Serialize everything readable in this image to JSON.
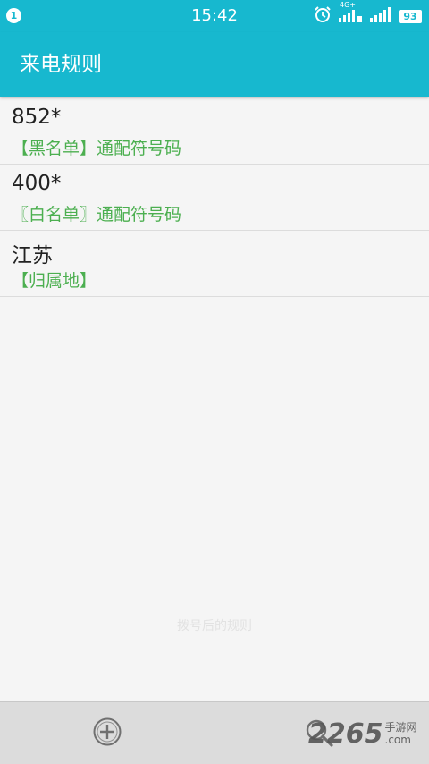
{
  "status_bar": {
    "notification_count": "1",
    "time": "15:42",
    "network_label": "4G+",
    "battery": "93",
    "icons": [
      "alarm-icon",
      "signal-4g-icon",
      "signal-icon"
    ]
  },
  "app_bar": {
    "title": "来电规则"
  },
  "rules": [
    {
      "number": "852*",
      "desc": "【黑名单】通配符号码"
    },
    {
      "number": "400*",
      "desc": "〖白名单〗通配符号码"
    },
    {
      "number": "江苏",
      "desc": "【归属地】"
    }
  ],
  "toast": "拨号后的规则",
  "bottom_bar": {
    "add_icon": "plus-circle-icon",
    "search_icon": "search-icon"
  },
  "watermark": {
    "number": "2265",
    "line1": "手游网",
    "line2": ".com"
  },
  "colors": {
    "primary": "#17b8cf",
    "accent_text": "#4caf50",
    "background": "#f5f5f5",
    "bottom_bar": "#dcdcdc"
  }
}
